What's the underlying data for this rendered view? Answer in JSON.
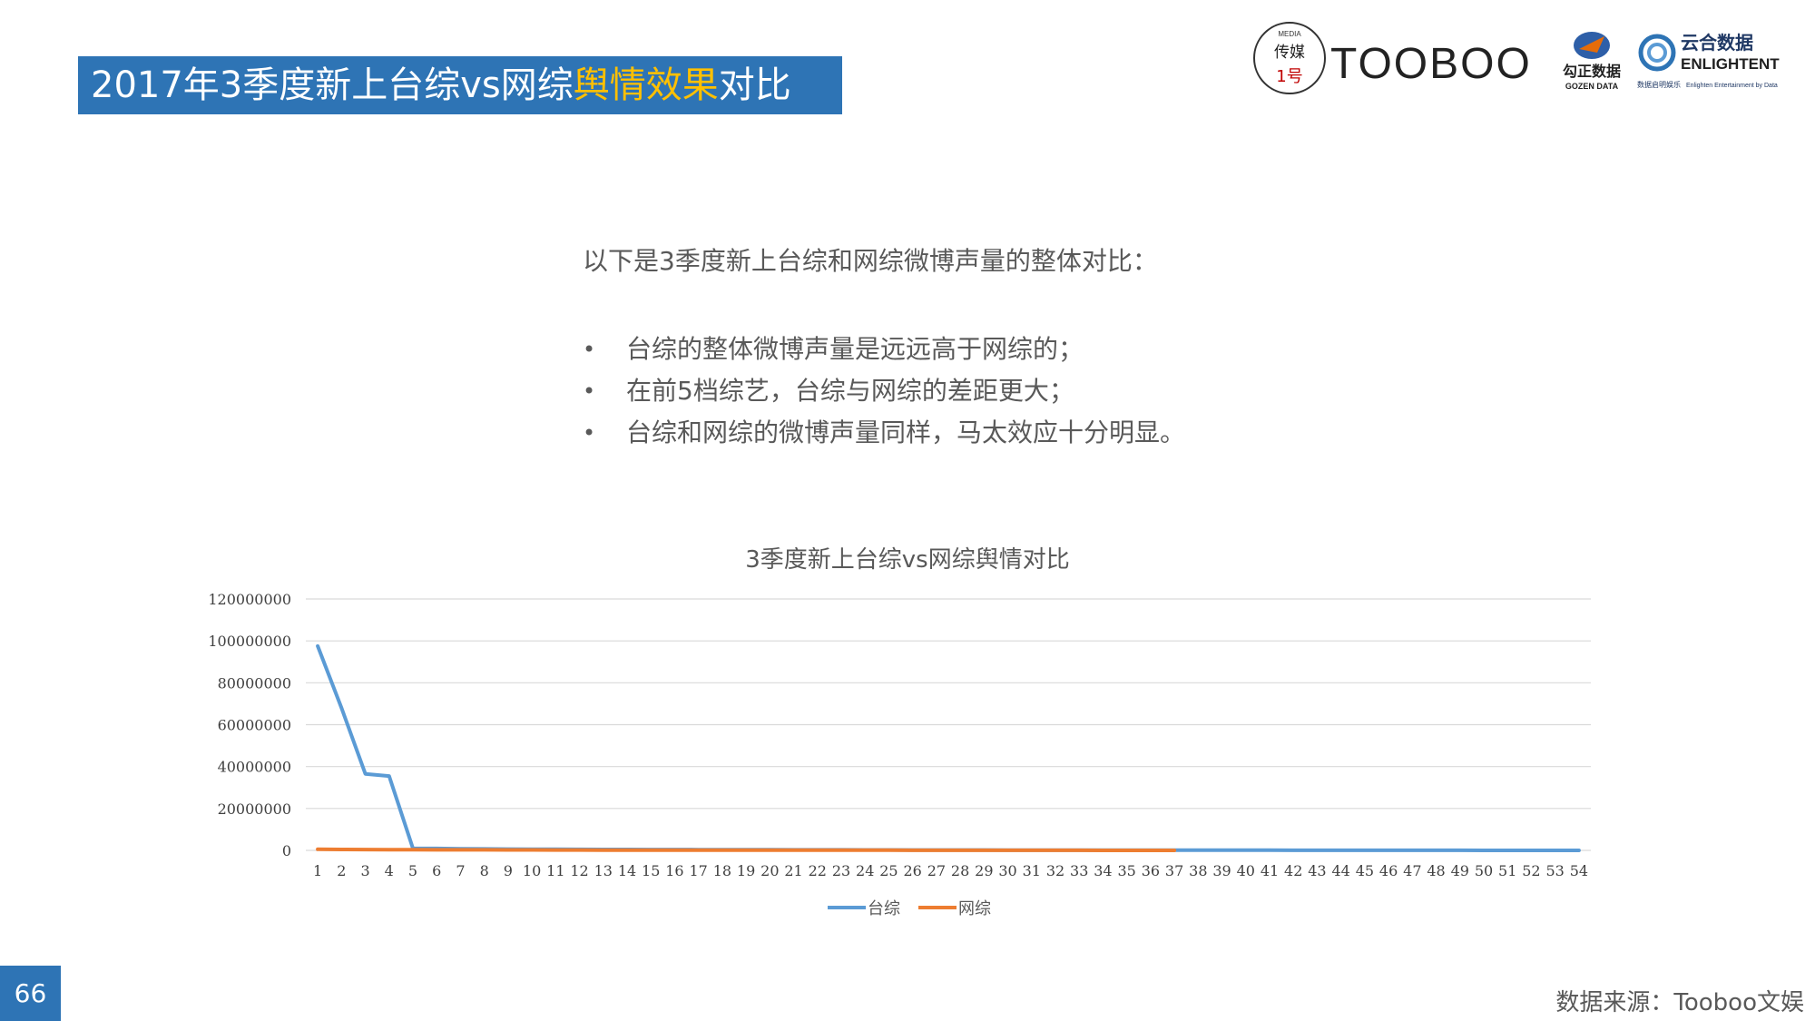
{
  "header": {
    "title_prefix": "2017年3季度新上台综vs网综",
    "title_highlight": "舆情效果",
    "title_suffix": "对比"
  },
  "logos": {
    "media_small": "MEDIA",
    "media_name": "传媒",
    "media_num": "1号",
    "tooboo": "TOOBOO",
    "gozen_cn": "勾正数据",
    "gozen_en": "GOZEN DATA",
    "enlight_cn": "云合数据",
    "enlight_en": "ENLIGHTENT",
    "enlight_sub_cn": "数据启明娱乐",
    "enlight_sub_en": "Enlighten Entertainment by Data"
  },
  "intro": "以下是3季度新上台综和网综微博声量的整体对比：",
  "bullets": [
    "台综的整体微博声量是远远高于网综的；",
    "在前5档综艺，台综与网综的差距更大；",
    "台综和网综的微博声量同样，马太效应十分明显。"
  ],
  "bullet_symbol": "•",
  "chart_data": {
    "type": "line",
    "title": "3季度新上台综vs网综舆情对比",
    "xlabel": "",
    "ylabel": "",
    "ylim": [
      0,
      120000000
    ],
    "yticks": [
      0,
      20000000,
      40000000,
      60000000,
      80000000,
      100000000,
      120000000
    ],
    "ytick_labels": [
      "0",
      "20000000",
      "40000000",
      "60000000",
      "80000000",
      "100000000",
      "120000000"
    ],
    "grid": true,
    "legend_position": "bottom",
    "categories": [
      "1",
      "2",
      "3",
      "4",
      "5",
      "6",
      "7",
      "8",
      "9",
      "10",
      "11",
      "12",
      "13",
      "14",
      "15",
      "16",
      "17",
      "18",
      "19",
      "20",
      "21",
      "22",
      "23",
      "24",
      "25",
      "26",
      "27",
      "28",
      "29",
      "30",
      "31",
      "32",
      "33",
      "34",
      "35",
      "36",
      "37",
      "38",
      "39",
      "40",
      "41",
      "42",
      "43",
      "44",
      "45",
      "46",
      "47",
      "48",
      "49",
      "50",
      "51",
      "52",
      "53",
      "54"
    ],
    "series": [
      {
        "name": "台综",
        "color": "#5b9bd5",
        "values": [
          97500000,
          68000000,
          36500000,
          35500000,
          1000000,
          900000,
          800000,
          700000,
          600000,
          550000,
          500000,
          480000,
          450000,
          420000,
          400000,
          380000,
          360000,
          340000,
          320000,
          300000,
          280000,
          260000,
          240000,
          220000,
          200000,
          190000,
          180000,
          170000,
          160000,
          150000,
          140000,
          130000,
          120000,
          110000,
          100000,
          90000,
          85000,
          80000,
          75000,
          70000,
          65000,
          60000,
          55000,
          50000,
          45000,
          40000,
          35000,
          30000,
          25000,
          20000,
          15000,
          12000,
          10000,
          8000
        ]
      },
      {
        "name": "网综",
        "color": "#ed7d31",
        "values": [
          500000,
          450000,
          400000,
          350000,
          300000,
          280000,
          260000,
          240000,
          220000,
          200000,
          180000,
          160000,
          150000,
          140000,
          130000,
          120000,
          110000,
          100000,
          95000,
          90000,
          85000,
          80000,
          75000,
          70000,
          65000,
          60000,
          55000,
          50000,
          45000,
          40000,
          35000,
          30000,
          25000,
          20000,
          15000,
          10000,
          5000
        ]
      }
    ]
  },
  "footer": {
    "page_number": "66",
    "source": "数据来源：Tooboo文娱"
  },
  "colors": {
    "title_bar": "#2e74b5",
    "highlight": "#ffc000",
    "series_tv": "#5b9bd5",
    "series_web": "#ed7d31",
    "grid": "#d9d9d9"
  }
}
